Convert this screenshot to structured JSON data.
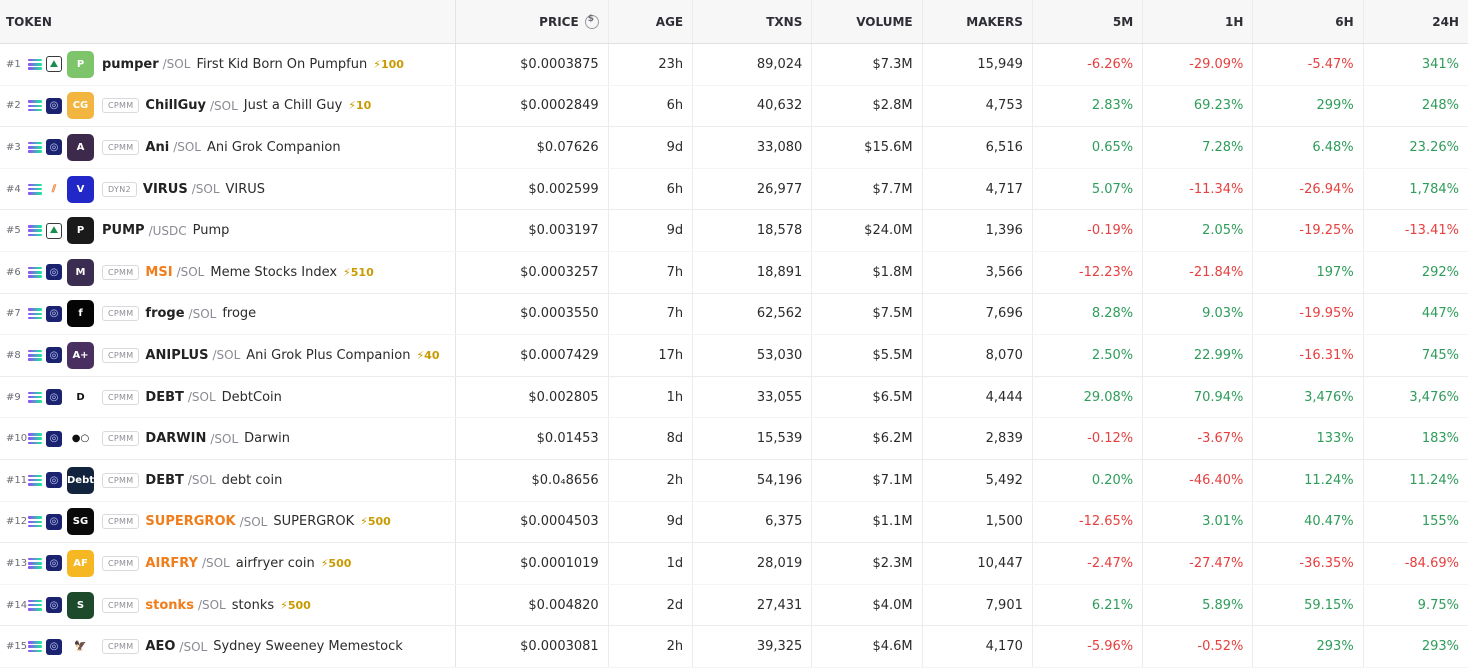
{
  "columns": {
    "token": "TOKEN",
    "price": "PRICE",
    "age": "AGE",
    "txns": "TXNS",
    "volume": "VOLUME",
    "makers": "MAKERS",
    "m5": "5M",
    "h1": "1H",
    "h6": "6H",
    "h24": "24H"
  },
  "colors": {
    "up": "#2e9c5a",
    "down": "#e5403f",
    "hot_symbol": "#f07d1a",
    "boost": "#c99a00"
  },
  "rows": [
    {
      "rank": "#1",
      "dex_icon": "pump-pill-icon",
      "tag": "",
      "symbol": "pumper",
      "quote": "/SOL",
      "name": "First Kid Born On Pumpfun",
      "boost": "⚡100",
      "price": "$0.0003875",
      "age": "23h",
      "txns": "89,024",
      "volume": "$7.3M",
      "makers": "15,949",
      "m5": "-6.26%",
      "h1": "-29.09%",
      "h6": "-5.47%",
      "h24": "341%",
      "avatar_color": "#7ec46a",
      "avatar_text": "P"
    },
    {
      "rank": "#2",
      "dex_icon": "raydium-icon",
      "tag": "CPMM",
      "symbol": "ChillGuy",
      "quote": "/SOL",
      "name": "Just a Chill Guy",
      "boost": "⚡10",
      "price": "$0.0002849",
      "age": "6h",
      "txns": "40,632",
      "volume": "$2.8M",
      "makers": "4,753",
      "m5": "2.83%",
      "h1": "69.23%",
      "h6": "299%",
      "h24": "248%",
      "avatar_color": "#f2b640",
      "avatar_text": "CG"
    },
    {
      "rank": "#3",
      "dex_icon": "raydium-icon",
      "tag": "CPMM",
      "symbol": "Ani",
      "quote": "/SOL",
      "name": "Ani Grok Companion",
      "boost": "",
      "price": "$0.07626",
      "age": "9d",
      "txns": "33,080",
      "volume": "$15.6M",
      "makers": "6,516",
      "m5": "0.65%",
      "h1": "7.28%",
      "h6": "6.48%",
      "h24": "23.26%",
      "avatar_color": "#3d2a4a",
      "avatar_text": "A"
    },
    {
      "rank": "#4",
      "dex_icon": "meteora-icon",
      "tag": "DYN2",
      "symbol": "VIRUS",
      "quote": "/SOL",
      "name": "VIRUS",
      "boost": "",
      "price": "$0.002599",
      "age": "6h",
      "txns": "26,977",
      "volume": "$7.7M",
      "makers": "4,717",
      "m5": "5.07%",
      "h1": "-11.34%",
      "h6": "-26.94%",
      "h24": "1,784%",
      "avatar_color": "#2228c8",
      "avatar_text": "V"
    },
    {
      "rank": "#5",
      "dex_icon": "pump-pill-icon",
      "tag": "",
      "symbol": "PUMP",
      "quote": "/USDC",
      "name": "Pump",
      "boost": "",
      "price": "$0.003197",
      "age": "9d",
      "txns": "18,578",
      "volume": "$24.0M",
      "makers": "1,396",
      "m5": "-0.19%",
      "h1": "2.05%",
      "h6": "-19.25%",
      "h24": "-13.41%",
      "avatar_color": "#1a1a1a",
      "avatar_text": "P"
    },
    {
      "rank": "#6",
      "dex_icon": "raydium-icon",
      "tag": "CPMM",
      "symbol": "MSI",
      "quote": "/SOL",
      "name": "Meme Stocks Index",
      "boost": "⚡510",
      "price": "$0.0003257",
      "age": "7h",
      "txns": "18,891",
      "volume": "$1.8M",
      "makers": "3,566",
      "m5": "-12.23%",
      "h1": "-21.84%",
      "h6": "197%",
      "h24": "292%",
      "avatar_color": "#3b2c52",
      "avatar_text": "M",
      "hot": true
    },
    {
      "rank": "#7",
      "dex_icon": "raydium-icon",
      "tag": "CPMM",
      "symbol": "froge",
      "quote": "/SOL",
      "name": "froge",
      "boost": "",
      "price": "$0.0003550",
      "age": "7h",
      "txns": "62,562",
      "volume": "$7.5M",
      "makers": "7,696",
      "m5": "8.28%",
      "h1": "9.03%",
      "h6": "-19.95%",
      "h24": "447%",
      "avatar_color": "#050505",
      "avatar_text": "f"
    },
    {
      "rank": "#8",
      "dex_icon": "raydium-icon",
      "tag": "CPMM",
      "symbol": "ANIPLUS",
      "quote": "/SOL",
      "name": "Ani Grok Plus Companion",
      "boost": "⚡40",
      "price": "$0.0007429",
      "age": "17h",
      "txns": "53,030",
      "volume": "$5.5M",
      "makers": "8,070",
      "m5": "2.50%",
      "h1": "22.99%",
      "h6": "-16.31%",
      "h24": "745%",
      "avatar_color": "#4a3060",
      "avatar_text": "A+"
    },
    {
      "rank": "#9",
      "dex_icon": "raydium-icon",
      "tag": "CPMM",
      "symbol": "DEBT",
      "quote": "/SOL",
      "name": "DebtCoin",
      "boost": "",
      "price": "$0.002805",
      "age": "1h",
      "txns": "33,055",
      "volume": "$6.5M",
      "makers": "4,444",
      "m5": "29.08%",
      "h1": "70.94%",
      "h6": "3,476%",
      "h24": "3,476%",
      "avatar_color": "#ffffff",
      "avatar_text": "D"
    },
    {
      "rank": "#10",
      "dex_icon": "raydium-icon",
      "tag": "CPMM",
      "symbol": "DARWIN",
      "quote": "/SOL",
      "name": "Darwin",
      "boost": "",
      "price": "$0.01453",
      "age": "8d",
      "txns": "15,539",
      "volume": "$6.2M",
      "makers": "2,839",
      "m5": "-0.12%",
      "h1": "-3.67%",
      "h6": "133%",
      "h24": "183%",
      "avatar_color": "#ffffff",
      "avatar_text": "●○"
    },
    {
      "rank": "#11",
      "dex_icon": "raydium-icon",
      "tag": "CPMM",
      "symbol": "DEBT",
      "quote": "/SOL",
      "name": "debt coin",
      "boost": "",
      "price": "$0.0₄8656",
      "age": "2h",
      "txns": "54,196",
      "volume": "$7.1M",
      "makers": "5,492",
      "m5": "0.20%",
      "h1": "-46.40%",
      "h6": "11.24%",
      "h24": "11.24%",
      "avatar_color": "#12233d",
      "avatar_text": "Debt"
    },
    {
      "rank": "#12",
      "dex_icon": "raydium-icon",
      "tag": "CPMM",
      "symbol": "SUPERGROK",
      "quote": "/SOL",
      "name": "SUPERGROK",
      "boost": "⚡500",
      "price": "$0.0004503",
      "age": "9d",
      "txns": "6,375",
      "volume": "$1.1M",
      "makers": "1,500",
      "m5": "-12.65%",
      "h1": "3.01%",
      "h6": "40.47%",
      "h24": "155%",
      "avatar_color": "#0a0a0a",
      "avatar_text": "SG",
      "hot": true
    },
    {
      "rank": "#13",
      "dex_icon": "raydium-icon",
      "tag": "CPMM",
      "symbol": "AIRFRY",
      "quote": "/SOL",
      "name": "airfryer coin",
      "boost": "⚡500",
      "price": "$0.0001019",
      "age": "1d",
      "txns": "28,019",
      "volume": "$2.3M",
      "makers": "10,447",
      "m5": "-2.47%",
      "h1": "-27.47%",
      "h6": "-36.35%",
      "h24": "-84.69%",
      "avatar_color": "#f5b722",
      "avatar_text": "AF",
      "hot": true
    },
    {
      "rank": "#14",
      "dex_icon": "raydium-icon",
      "tag": "CPMM",
      "symbol": "stonks",
      "quote": "/SOL",
      "name": "stonks",
      "boost": "⚡500",
      "price": "$0.004820",
      "age": "2d",
      "txns": "27,431",
      "volume": "$4.0M",
      "makers": "7,901",
      "m5": "6.21%",
      "h1": "5.89%",
      "h6": "59.15%",
      "h24": "9.75%",
      "avatar_color": "#1d4a2a",
      "avatar_text": "S",
      "hot": true
    },
    {
      "rank": "#15",
      "dex_icon": "raydium-icon",
      "tag": "CPMM",
      "symbol": "AEO",
      "quote": "/SOL",
      "name": "Sydney Sweeney Memestock",
      "boost": "",
      "price": "$0.0003081",
      "age": "2h",
      "txns": "39,325",
      "volume": "$4.6M",
      "makers": "4,170",
      "m5": "-5.96%",
      "h1": "-0.52%",
      "h6": "293%",
      "h24": "293%",
      "avatar_color": "#ffffff",
      "avatar_text": "🦅"
    }
  ]
}
